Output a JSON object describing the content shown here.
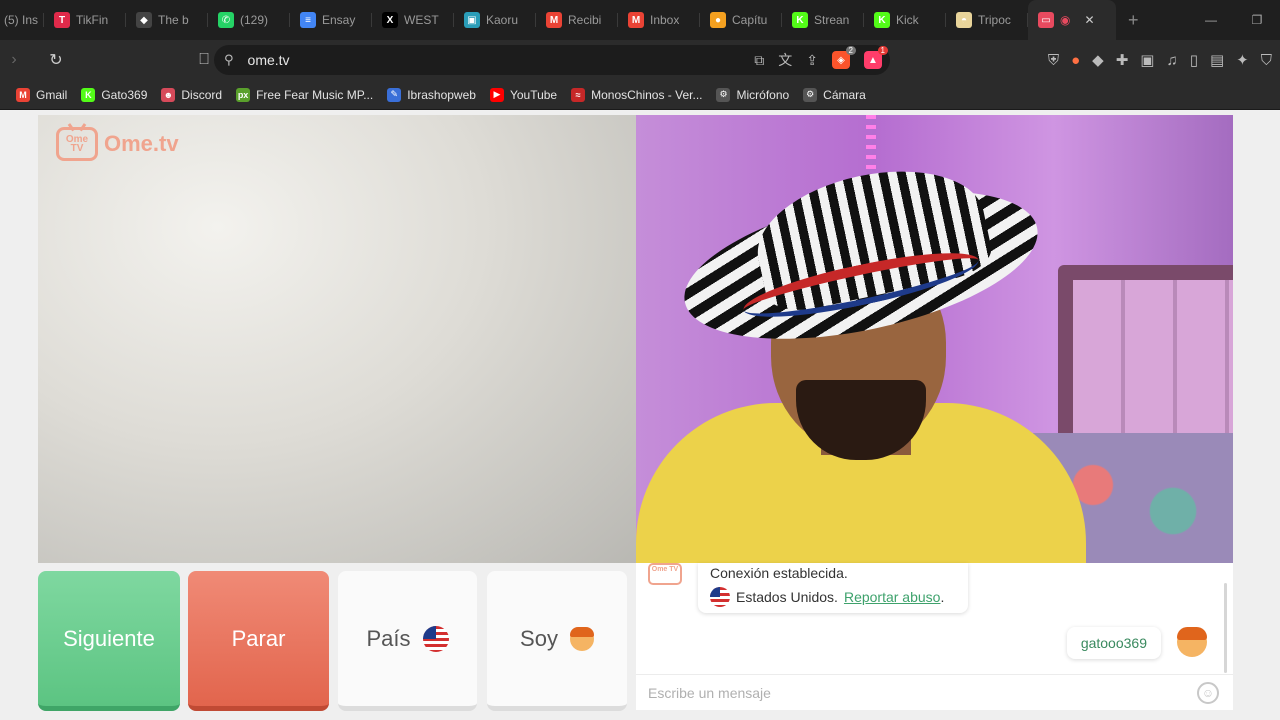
{
  "tabs": [
    {
      "label": "(5) Ins",
      "color": "#c13584",
      "glyph": ""
    },
    {
      "label": "TikFin",
      "color": "#e02a4a",
      "glyph": "T"
    },
    {
      "label": "The b",
      "color": "#444444",
      "glyph": "◆"
    },
    {
      "label": "(129)",
      "color": "#25d366",
      "glyph": "✆"
    },
    {
      "label": "Ensay",
      "color": "#4285f4",
      "glyph": "≡"
    },
    {
      "label": "WEST",
      "color": "#000000",
      "glyph": "X"
    },
    {
      "label": "Kaoru",
      "color": "#2a9db8",
      "glyph": "▣"
    },
    {
      "label": "Recibi",
      "color": "#ea4335",
      "glyph": "M"
    },
    {
      "label": "Inbox",
      "color": "#ea4335",
      "glyph": "M"
    },
    {
      "label": "Capítu",
      "color": "#f4a020",
      "glyph": "●"
    },
    {
      "label": "Strean",
      "color": "#53fc18",
      "glyph": "K"
    },
    {
      "label": "Kick",
      "color": "#53fc18",
      "glyph": "K"
    },
    {
      "label": "Tripoc",
      "color": "#e8d49a",
      "glyph": "◓"
    }
  ],
  "address": {
    "url": "ome.tv"
  },
  "bookmarks": [
    {
      "label": "Gmail",
      "color": "#ea4335",
      "glyph": "M"
    },
    {
      "label": "Gato369",
      "color": "#53fc18",
      "glyph": "K"
    },
    {
      "label": "Discord",
      "color": "#d64a5a",
      "glyph": "☻"
    },
    {
      "label": "Free Fear Music MP...",
      "color": "#5aa02c",
      "glyph": "px"
    },
    {
      "label": "Ibrashopweb",
      "color": "#3a6fd8",
      "glyph": "✎"
    },
    {
      "label": "YouTube",
      "color": "#ff0000",
      "glyph": "▶"
    },
    {
      "label": "MonosChinos - Ver...",
      "color": "#c62828",
      "glyph": "≈"
    },
    {
      "label": "Micrófono",
      "color": "#555555",
      "glyph": "⚙"
    },
    {
      "label": "Cámara",
      "color": "#555555",
      "glyph": "⚙"
    }
  ],
  "logo": {
    "text": "Ome.tv",
    "badge": "Ome TV"
  },
  "controls": {
    "next": "Siguiente",
    "stop": "Parar",
    "country": "País",
    "gender": "Soy"
  },
  "chat": {
    "logo_badge": "Ome TV",
    "system_line1": "Conexión establecida.",
    "system_country": "Estados Unidos.",
    "report_link": "Reportar abuso",
    "report_period": ".",
    "my_message": "gatooo369",
    "input_placeholder": "Escribe un mensaje"
  },
  "colors": {
    "next_button": "#5cc482",
    "stop_button": "#e2654d",
    "brand": "#f0a48e",
    "link": "#3ea26c"
  }
}
